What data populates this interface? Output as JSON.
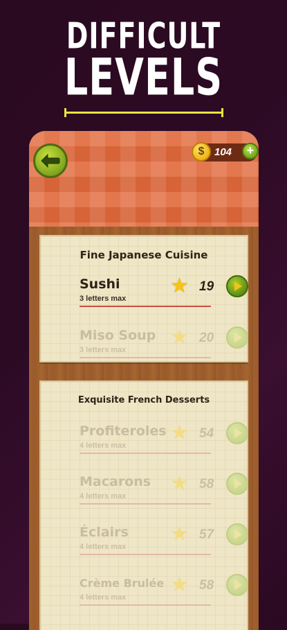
{
  "headline": {
    "line1": "DIFFICULT",
    "line2": "LEVELS"
  },
  "toolbar": {
    "coin_symbol": "$",
    "coin_count": "104",
    "plus_label": "+"
  },
  "categories": [
    {
      "title": "Fine Japanese Cuisine",
      "levels": [
        {
          "name": "Sushi",
          "subtitle": "3 letters max",
          "number": "19",
          "state": "unlocked"
        },
        {
          "name": "Miso Soup",
          "subtitle": "3 letters max",
          "number": "20",
          "state": "locked"
        }
      ]
    },
    {
      "title": "Exquisite French Desserts",
      "levels": [
        {
          "name": "Profiteroles",
          "subtitle": "4 letters max",
          "number": "54",
          "state": "locked"
        },
        {
          "name": "Macarons",
          "subtitle": "4 letters max",
          "number": "58",
          "state": "locked"
        },
        {
          "name": "Éclairs",
          "subtitle": "4 letters max",
          "number": "57",
          "state": "locked"
        },
        {
          "name": "Crème Brulée",
          "subtitle": "4 letters max",
          "number": "58",
          "state": "locked"
        }
      ]
    }
  ],
  "icons": {
    "back": "back-arrow-icon",
    "coin": "coin-icon",
    "plus": "plus-icon",
    "star": "star-icon",
    "play": "play-icon"
  },
  "colors": {
    "background": "#2c0a24",
    "accent_yellow": "#e9e442",
    "topbar_orange": "#e0683a",
    "button_green": "#7fa51f",
    "star_gold": "#f4c518",
    "card_paper": "#efe6c6"
  }
}
